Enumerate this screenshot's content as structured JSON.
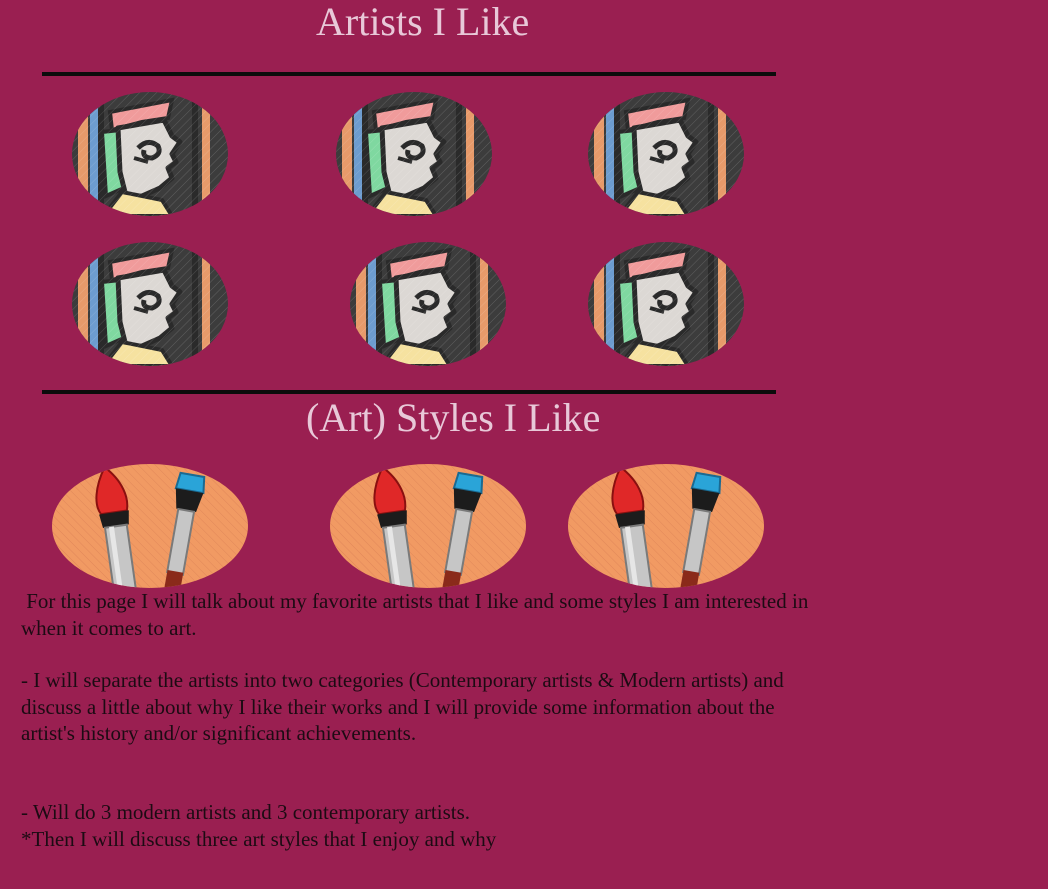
{
  "page": {
    "background": "#9a1f51",
    "heading_color": "#e8c8d8"
  },
  "artists_section": {
    "title": "Artists I Like",
    "thumbnails": [
      {
        "icon": "artist-portrait-icon"
      },
      {
        "icon": "artist-portrait-icon"
      },
      {
        "icon": "artist-portrait-icon"
      },
      {
        "icon": "artist-portrait-icon"
      },
      {
        "icon": "artist-portrait-icon"
      },
      {
        "icon": "artist-portrait-icon"
      }
    ]
  },
  "styles_section": {
    "title": "(Art) Styles I Like",
    "thumbnails": [
      {
        "icon": "paintbrushes-icon"
      },
      {
        "icon": "paintbrushes-icon"
      },
      {
        "icon": "paintbrushes-icon"
      }
    ]
  },
  "body": {
    "para1_line1": " For this page I will talk about my favorite artists that I like and some styles I am interested in",
    "para1_line2": "when it comes to art.",
    "para2_line1": "- I will separate the artists into two categories (Contemporary artists & Modern artists) and",
    "para2_line2": "discuss a little about why I like their works and I will provide some information about the",
    "para2_line3": "artist's history and/or significant achievements.",
    "para3_line1": "- Will do 3 modern artists and 3 contemporary artists.",
    "para3_line2": "*Then I will discuss three art styles that I enjoy and why"
  }
}
